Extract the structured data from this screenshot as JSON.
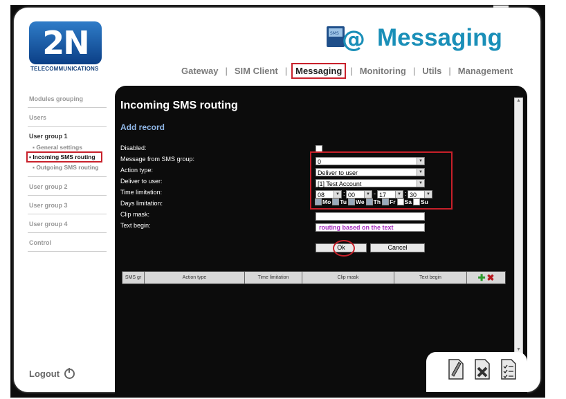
{
  "brand": {
    "logo_text": "2N",
    "tagline": "TELECOMMUNICATIONS"
  },
  "app": {
    "title": "Messaging",
    "icon": "sms-at-icon"
  },
  "topnav": [
    "Gateway",
    "SIM Client",
    "Messaging",
    "Monitoring",
    "Utils",
    "Management"
  ],
  "topnav_active": "Messaging",
  "sidebar": {
    "modules": "Modules grouping",
    "users": "Users",
    "group1": "User group 1",
    "general": "General settings",
    "incoming": "Incoming SMS routing",
    "outgoing": "Outgoing SMS routing",
    "group2": "User group 2",
    "group3": "User group 3",
    "group4": "User group 4",
    "control": "Control"
  },
  "logout": "Logout",
  "panel": {
    "title": "Incoming SMS routing",
    "subtitle": "Add record"
  },
  "form": {
    "disabled": "Disabled:",
    "sms_group": "Message from SMS group:",
    "action_type": "Action type:",
    "deliver_to": "Deliver to user:",
    "time_limit": "Time limitation:",
    "days_limit": "Days limitation:",
    "clip_mask": "Clip mask:",
    "text_begin": "Text begin:",
    "sms_group_value": "0",
    "action_type_value": "Deliver to user",
    "deliver_to_value": "[1] Test Account",
    "time_from_h": "08",
    "time_from_m": "00",
    "time_to_h": "17",
    "time_to_m": "30",
    "text_begin_value": "routing based on the text",
    "ok": "Ok",
    "cancel": "Cancel"
  },
  "days": [
    {
      "label": "Mo",
      "checked": true
    },
    {
      "label": "Tu",
      "checked": true
    },
    {
      "label": "We",
      "checked": true
    },
    {
      "label": "Th",
      "checked": true
    },
    {
      "label": "Fr",
      "checked": true
    },
    {
      "label": "Sa",
      "checked": false
    },
    {
      "label": "Su",
      "checked": false
    }
  ],
  "table": {
    "headers": [
      "SMS gr",
      "Action type",
      "Time limitation",
      "Clip mask",
      "Text begin"
    ]
  },
  "colors": {
    "accent": "#1a8fb8",
    "highlight": "#c8202a",
    "panel": "#0c0c0c"
  }
}
